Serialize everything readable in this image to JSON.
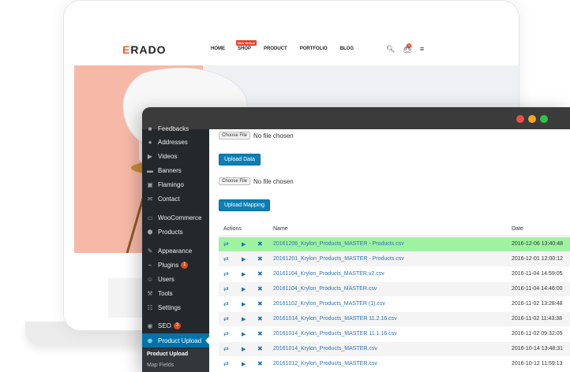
{
  "site": {
    "logo_prefix": "E",
    "logo_rest": "RADO",
    "nav": [
      "HOME",
      "SHOP",
      "PRODUCT",
      "PORTFOLIO",
      "BLOG"
    ],
    "new_badge": "New Arrival",
    "cart_count": "0",
    "icons": [
      "search-icon",
      "cart-icon",
      "menu-icon"
    ]
  },
  "window": {
    "traffic_lights": [
      "#ec5149",
      "#f5a623",
      "#2fc24a"
    ]
  },
  "sidebar": {
    "items": [
      {
        "label": "Feedbacks",
        "icon": "chat-icon"
      },
      {
        "label": "Addresses",
        "icon": "pin-icon"
      },
      {
        "label": "Videos",
        "icon": "video-icon"
      },
      {
        "label": "Banners",
        "icon": "banner-icon"
      },
      {
        "label": "Flamingo",
        "icon": "flamingo-icon"
      },
      {
        "label": "Contact",
        "icon": "mail-icon"
      },
      {
        "label": "WooCommerce",
        "icon": "woocommerce-icon"
      },
      {
        "label": "Products",
        "icon": "box-icon"
      },
      {
        "label": "Appearance",
        "icon": "brush-icon"
      },
      {
        "label": "Plugins",
        "icon": "plug-icon",
        "badge": "1"
      },
      {
        "label": "Users",
        "icon": "user-icon"
      },
      {
        "label": "Tools",
        "icon": "wrench-icon"
      },
      {
        "label": "Settings",
        "icon": "settings-icon"
      },
      {
        "label": "SEO",
        "icon": "seo-icon",
        "badge": "3"
      },
      {
        "label": "Product Upload",
        "icon": "plus-icon"
      }
    ],
    "submenu": {
      "active": "Product Upload",
      "other": "Map Fields"
    }
  },
  "upload_data": {
    "choose_label": "Choose File",
    "status": "No file chosen",
    "button": "Upload Data"
  },
  "upload_mapping": {
    "choose_label": "Choose File",
    "status": "No file chosen",
    "button": "Upload Mapping"
  },
  "table": {
    "headers": {
      "actions": "Actions",
      "name": "Name",
      "date": "Date"
    },
    "rows": [
      {
        "name": "20161206_Krylon_Products_MASTER - Products.csv",
        "date": "2016-12-06 13:40:48",
        "highlight": true
      },
      {
        "name": "20161201_Krylon_Products_MASTER - Products.csv",
        "date": "2016-12-01 12:00:12"
      },
      {
        "name": "20161104_Krylon_Products_MASTER.v2.csv",
        "date": "2016-11-04 14:59:05"
      },
      {
        "name": "20161104_Krylon_Products_MASTER.csv",
        "date": "2016-11-04 14:46:00"
      },
      {
        "name": "20161102_Krylon_Products_MASTER (1).csv",
        "date": "2016-11-02 13:28:48"
      },
      {
        "name": "20161014_Krylon_Products_MASTER 11.2.16.csv",
        "date": "2016-11-02 11:43:38"
      },
      {
        "name": "20161014_Krylon_Products_MASTER 11.1.16.csv",
        "date": "2016-11-02 09:32:05"
      },
      {
        "name": "20161014_Krylon_Products_MASTER.csv",
        "date": "2016-10-14 13:48:31"
      },
      {
        "name": "20161012_Krylon_Products_MASTER.csv",
        "date": "2016-10-12 11:59:13"
      }
    ]
  }
}
